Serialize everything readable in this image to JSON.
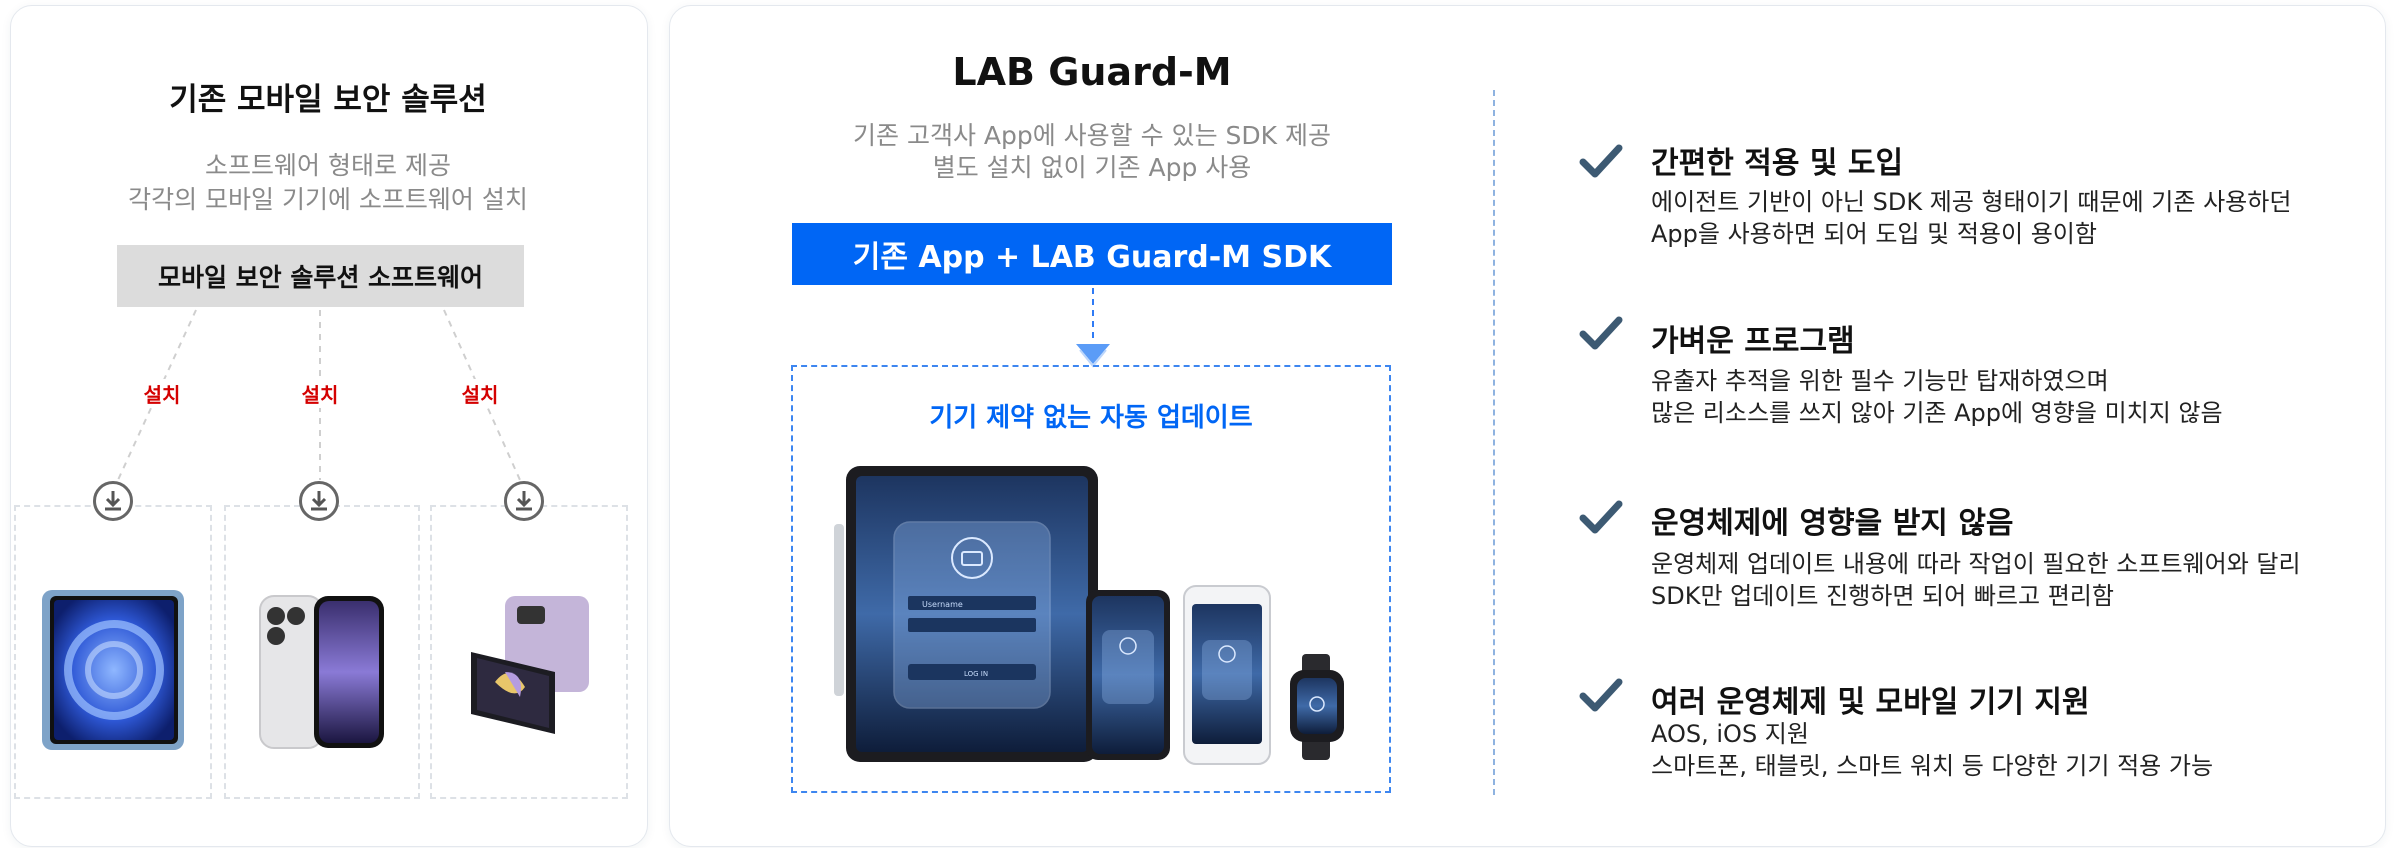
{
  "left": {
    "title": "기존 모바일 보안 솔루션",
    "desc_line1": "소프트웨어 형태로 제공",
    "desc_line2": "각각의 모바일 기기에 소프트웨어 설치",
    "software_label": "모바일 보안 솔루션 소프트웨어",
    "install_labels": [
      "설치",
      "설치",
      "설치"
    ],
    "devices": [
      "tablet-device",
      "phone-device",
      "foldable-device"
    ]
  },
  "middle": {
    "title": "LAB Guard-M",
    "desc_line1": "기존 고객사 App에 사용할 수 있는 SDK 제공",
    "desc_line2": "별도 설치 없이 기존 App 사용",
    "sdk_label": "기존 App + LAB Guard-M SDK",
    "update_label": "기기 제약 없는 자동 업데이트",
    "mock_username": "Username",
    "mock_login": "LOG IN"
  },
  "features": [
    {
      "heading": "간편한 적용 및 도입",
      "lines": [
        "에이전트 기반이 아닌 SDK 제공 형태이기 때문에 기존 사용하던",
        "App을 사용하면 되어 도입 및 적용이 용이함"
      ]
    },
    {
      "heading": "가벼운 프로그램",
      "lines": [
        "유출자 추적을 위한 필수 기능만 탑재하였으며",
        "많은 리소스를 쓰지 않아 기존 App에 영향을 미치지 않음"
      ]
    },
    {
      "heading": "운영체제에 영향을 받지 않음",
      "lines": [
        "운영체제 업데이트 내용에 따라 작업이 필요한 소프트웨어와 달리",
        "SDK만 업데이트 진행하면 되어 빠르고 편리함"
      ]
    },
    {
      "heading": "여러 운영체제 및 모바일 기기 지원",
      "lines": [
        "AOS, iOS 지원",
        "스마트폰, 태블릿, 스마트 워치 등 다양한 기기 적용 가능"
      ]
    }
  ],
  "colors": {
    "accent": "#0066f5",
    "install_red": "#d40000",
    "check": "#3d5a73",
    "gray_box": "#dcdcdc"
  }
}
